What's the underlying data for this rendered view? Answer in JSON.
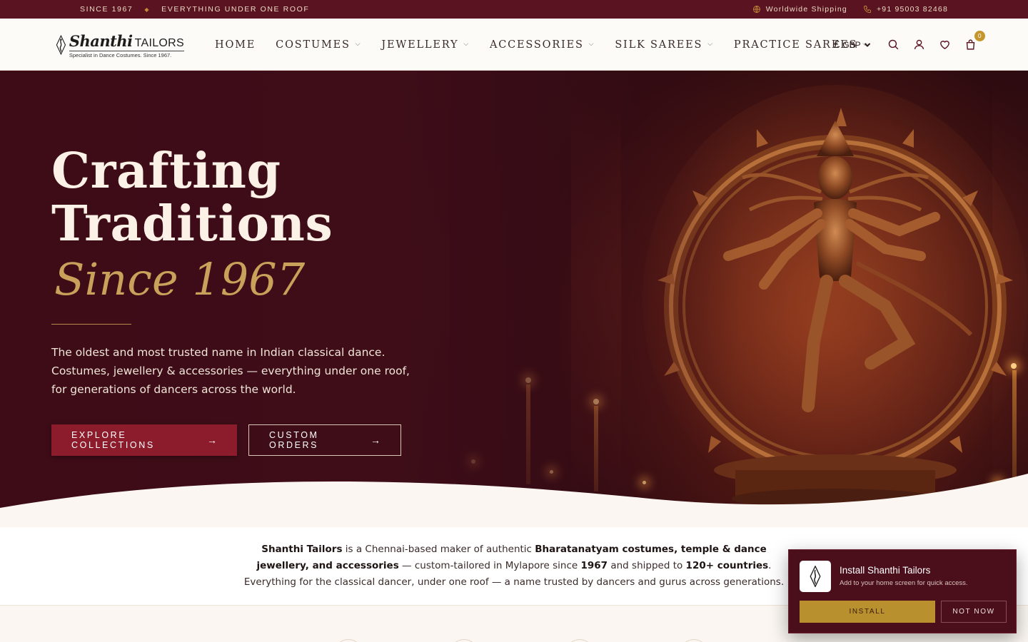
{
  "topbar": {
    "since": "SINCE 1967",
    "separator": "◆",
    "tagline": "EVERYTHING UNDER ONE ROOF",
    "shipping": "Worldwide Shipping",
    "phone": "+91 95003 82468"
  },
  "header": {
    "logo": {
      "brand_main": "Shanthi",
      "brand_suffix": "TAILORS",
      "tagline": "Specialist in Dance Costumes. Since 1967."
    },
    "nav": [
      {
        "label": "HOME",
        "has_dropdown": false
      },
      {
        "label": "COSTUMES",
        "has_dropdown": true
      },
      {
        "label": "JEWELLERY",
        "has_dropdown": true
      },
      {
        "label": "ACCESSORIES",
        "has_dropdown": true
      },
      {
        "label": "SILK SAREES",
        "has_dropdown": true
      },
      {
        "label": "PRACTICE SAREES",
        "has_dropdown": true
      }
    ],
    "currency": {
      "symbol": "£",
      "code": "GBP"
    },
    "icons": [
      "search-icon",
      "account-icon",
      "wishlist-icon",
      "cart-icon"
    ],
    "cart_count": "0"
  },
  "hero": {
    "title_line1": "Crafting",
    "title_line2": "Traditions",
    "subtitle": "Since 1967",
    "description": "The oldest and most trusted name in Indian classical dance. Costumes, jewellery & accessories — everything under one roof, for generations of dancers across the world.",
    "primary_cta": "EXPLORE COLLECTIONS",
    "secondary_cta": "CUSTOM ORDERS",
    "arrow": "→"
  },
  "intro": {
    "brand": "Shanthi Tailors",
    "t1": " is a Chennai-based maker of authentic ",
    "highlight1": "Bharatanatyam costumes, temple & dance jewellery, and accessories",
    "t2": " — custom-tailored in Mylapore since ",
    "year": "1967",
    "t3": " and shipped to ",
    "countries": "120+ countries",
    "t4": ". Everything for the classical dancer, under one roof — a name trusted by dancers and gurus across generations."
  },
  "install_prompt": {
    "title": "Install Shanthi Tailors",
    "subtitle": "Add to your home screen for quick access.",
    "install_label": "INSTALL",
    "dismiss_label": "NOT NOW"
  },
  "colors": {
    "topbar_bg": "#5a1421",
    "primary": "#8c1b2c",
    "gold": "#c9a15a",
    "hero_bg": "#3e0d18",
    "install_btn": "#b8902e"
  }
}
